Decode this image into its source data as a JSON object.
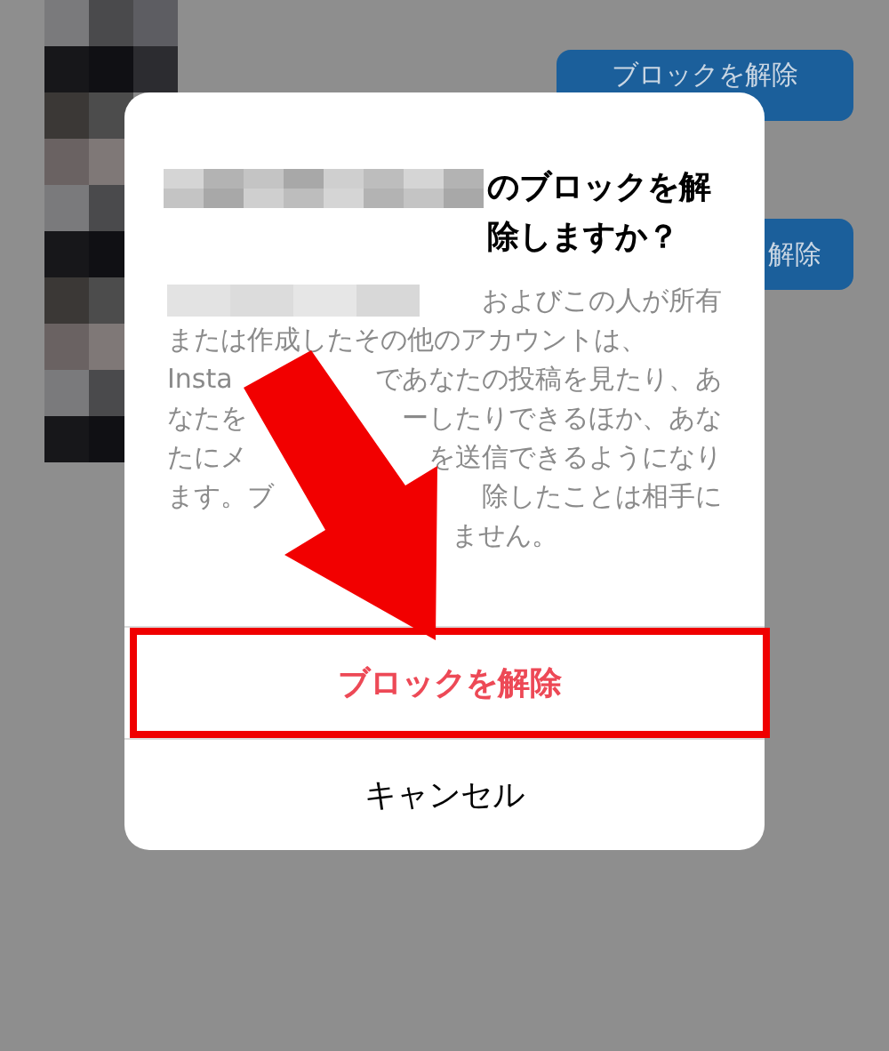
{
  "background_list": {
    "rows": [
      {
        "button": "ブロックを解除"
      },
      {
        "button": "解除"
      }
    ]
  },
  "dialog": {
    "title": "のブロックを解除しますか？",
    "body_lines": [
      {
        "kind": "name_lead",
        "segments": [
          "およびこの人が所有"
        ]
      },
      {
        "kind": "full",
        "segments": [
          "または作成したその他のアカウントは、"
        ]
      },
      {
        "kind": "split",
        "segments": [
          "Insta",
          "であなたの投稿を見たり、あ"
        ]
      },
      {
        "kind": "split",
        "segments": [
          "なたを",
          "ーしたりできるほか、あな"
        ]
      },
      {
        "kind": "split",
        "segments": [
          "たにメ",
          "を送信できるようになり"
        ]
      },
      {
        "kind": "split",
        "segments": [
          "ます。ブ",
          "除したことは相手に"
        ]
      },
      {
        "kind": "tail",
        "segments": [
          "ません。"
        ]
      }
    ],
    "buttons": [
      {
        "label": "ブロックを解除",
        "kind": "destructive",
        "highlighted": true
      },
      {
        "label": "キャンセル",
        "kind": "plain",
        "highlighted": false
      }
    ]
  }
}
